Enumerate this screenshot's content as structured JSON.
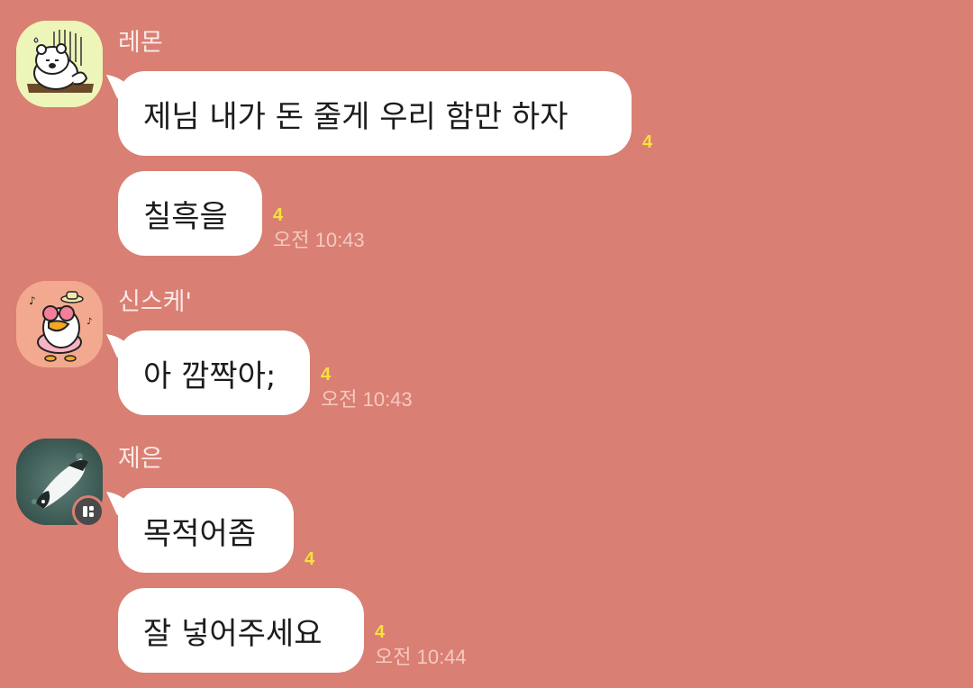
{
  "colors": {
    "background": "#d97f74",
    "bubble": "#ffffff",
    "unread": "#f7e23b",
    "time": "#f6c9c0",
    "name": "#fbe9e5"
  },
  "groups": [
    {
      "sender": "레몬",
      "avatar_icon": "bear-sticker-icon",
      "messages": [
        {
          "text": "제님 내가 돈 줄게 우리 함만 하자",
          "unread": "4",
          "time": ""
        },
        {
          "text": "칠흑을",
          "unread": "4",
          "time": "오전 10:43"
        }
      ]
    },
    {
      "sender": "신스케'",
      "avatar_icon": "duck-sticker-icon",
      "messages": [
        {
          "text": "아 깜짝아;",
          "unread": "4",
          "time": "오전 10:43"
        }
      ]
    },
    {
      "sender": "제은",
      "avatar_icon": "penguin-photo-icon",
      "badge_icon": "device-badge-icon",
      "messages": [
        {
          "text": "목적어좀",
          "unread": "4",
          "time": ""
        },
        {
          "text": "잘 넣어주세요",
          "unread": "4",
          "time": "오전 10:44"
        }
      ]
    }
  ]
}
